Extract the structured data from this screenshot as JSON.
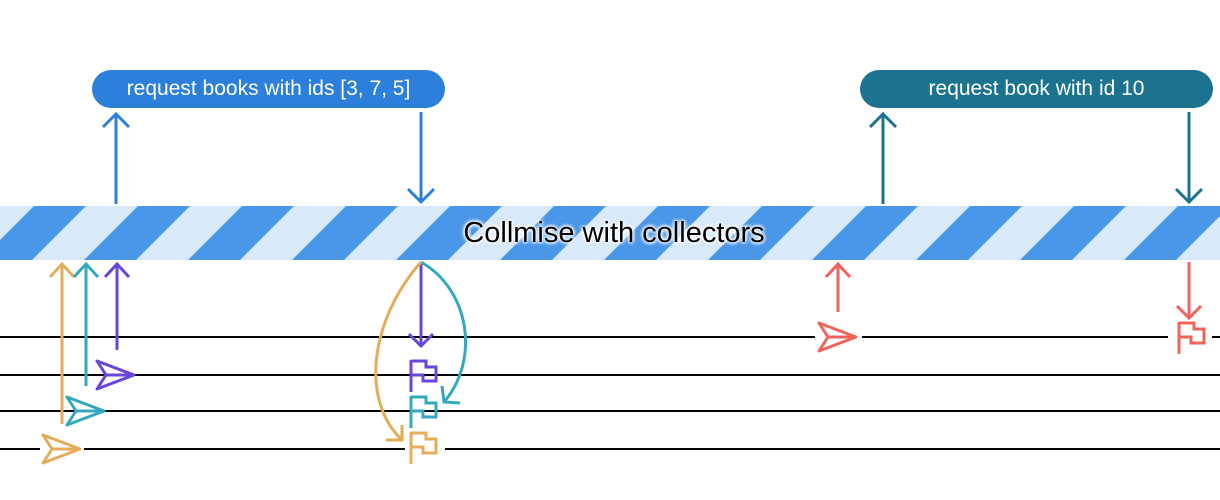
{
  "requests": {
    "batch_label": "request books with ids [3, 7, 5]",
    "single_label": "request book with id 10"
  },
  "band": {
    "label": "Collmise with collectors"
  },
  "colors": {
    "batch_request": "#2d7fdc",
    "single_request": "#1b7390",
    "band_stripe": "#4a96e8",
    "band_background": "#d8e9fb",
    "timeline": "#000000",
    "caller_purple": "#6a45dc",
    "caller_teal": "#33a9bd",
    "caller_orange": "#e5ac5a",
    "caller_red": "#f0645c"
  },
  "icons": [
    "send-icon",
    "flag-icon",
    "arrow-up-icon",
    "arrow-down-icon"
  ]
}
